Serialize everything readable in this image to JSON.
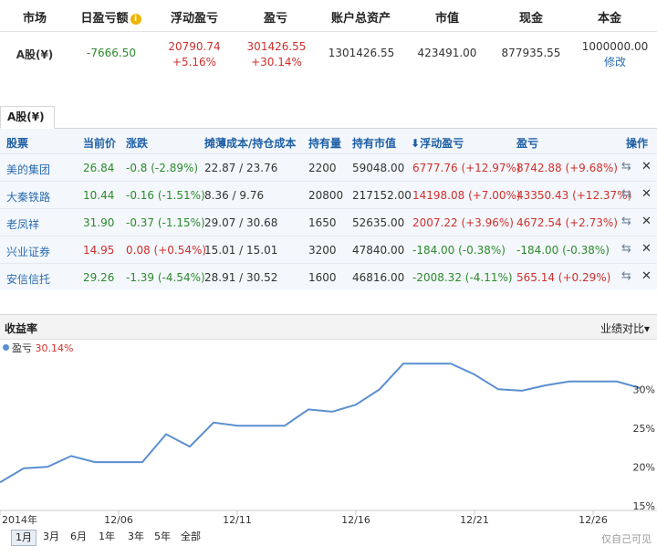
{
  "summary": {
    "headers": {
      "market": "市场",
      "daily_pl": "日盈亏额",
      "floating_pl": "浮动盈亏",
      "pl": "盈亏",
      "total_assets": "账户总资产",
      "market_value": "市值",
      "cash": "现金",
      "principal": "本金"
    },
    "info_icon": "i",
    "row": {
      "market": "A股(¥)",
      "daily_pl": "-7666.50",
      "floating_pl": "20790.74",
      "floating_pl_pct": "+5.16%",
      "pl": "301426.55",
      "pl_pct": "+30.14%",
      "total_assets": "1301426.55",
      "market_value": "423491.00",
      "cash": "877935.55",
      "principal": "1000000.00",
      "edit_link": "修改"
    }
  },
  "holdings": {
    "tab": "A股(¥)",
    "columns": {
      "stock": "股票",
      "price": "当前价",
      "change": "涨跌",
      "cost": "摊薄成本/持仓成本",
      "qty": "持有量",
      "value": "持有市值",
      "floating": "浮动盈亏",
      "floating_arrow": "⬇",
      "pl": "盈亏",
      "action": "操作"
    },
    "swap_icon": "⇆",
    "delete_icon": "✕",
    "rows": [
      {
        "name": "美的集团",
        "price": "26.84",
        "change": "-0.8 (-2.89%)",
        "cost": "22.87 / 23.76",
        "qty": "2200",
        "value": "59048.00",
        "floating": "6777.76 (+12.97%)",
        "pl": "8742.88 (+9.68%)",
        "price_color": "#2d8a2d",
        "change_color": "#2d8a2d",
        "floating_color": "#d0302d",
        "pl_color": "#d0302d"
      },
      {
        "name": "大秦铁路",
        "price": "10.44",
        "change": "-0.16 (-1.51%)",
        "cost": "8.36 / 9.76",
        "qty": "20800",
        "value": "217152.00",
        "floating": "14198.08 (+7.00%)",
        "pl": "43350.43 (+12.37%)",
        "price_color": "#2d8a2d",
        "change_color": "#2d8a2d",
        "floating_color": "#d0302d",
        "pl_color": "#d0302d"
      },
      {
        "name": "老凤祥",
        "price": "31.90",
        "change": "-0.37 (-1.15%)",
        "cost": "29.07 / 30.68",
        "qty": "1650",
        "value": "52635.00",
        "floating": "2007.22 (+3.96%)",
        "pl": "4672.54 (+2.73%)",
        "price_color": "#2d8a2d",
        "change_color": "#2d8a2d",
        "floating_color": "#d0302d",
        "pl_color": "#d0302d"
      },
      {
        "name": "兴业证券",
        "price": "14.95",
        "change": "0.08 (+0.54%)",
        "cost": "15.01 / 15.01",
        "qty": "3200",
        "value": "47840.00",
        "floating": "-184.00 (-0.38%)",
        "pl": "-184.00 (-0.38%)",
        "price_color": "#d0302d",
        "change_color": "#d0302d",
        "floating_color": "#2d8a2d",
        "pl_color": "#2d8a2d"
      },
      {
        "name": "安信信托",
        "price": "29.26",
        "change": "-1.39 (-4.54%)",
        "cost": "28.91 / 30.52",
        "qty": "1600",
        "value": "46816.00",
        "floating": "-2008.32 (-4.11%)",
        "pl": "565.14 (+0.29%)",
        "price_color": "#2d8a2d",
        "change_color": "#2d8a2d",
        "floating_color": "#2d8a2d",
        "pl_color": "#d0302d"
      }
    ]
  },
  "chart_section": {
    "title": "收益率",
    "compare_label": "业绩对比",
    "compare_arrow": "▾",
    "legend_label": "盈亏",
    "legend_value": "30.14%",
    "private_note": "仅自己可见",
    "ranges": [
      "1月",
      "3月",
      "6月",
      "1年",
      "3年",
      "5年",
      "全部"
    ],
    "active_range": "1月"
  },
  "chart_data": {
    "type": "line",
    "series": [
      {
        "name": "盈亏",
        "color": "#5b8fd0",
        "values": [
          18.0,
          19.8,
          20.0,
          21.4,
          20.6,
          20.6,
          20.6,
          24.2,
          22.6,
          25.7,
          25.3,
          25.3,
          25.3,
          27.4,
          27.1,
          28.0,
          30.0,
          33.3,
          33.3,
          33.3,
          31.9,
          30.0,
          29.8,
          30.5,
          31.0,
          31.0,
          31.0,
          30.14
        ]
      }
    ],
    "x_tick_labels": [
      "2014年",
      "12/06",
      "12/11",
      "12/16",
      "12/21",
      "12/26"
    ],
    "y_tick_labels": [
      "15%",
      "20%",
      "25%",
      "30%"
    ],
    "y_ticks": [
      15,
      20,
      25,
      30
    ],
    "ylim": [
      14.5,
      34.5
    ],
    "grid": false,
    "line_color": "#5b8fd0"
  }
}
